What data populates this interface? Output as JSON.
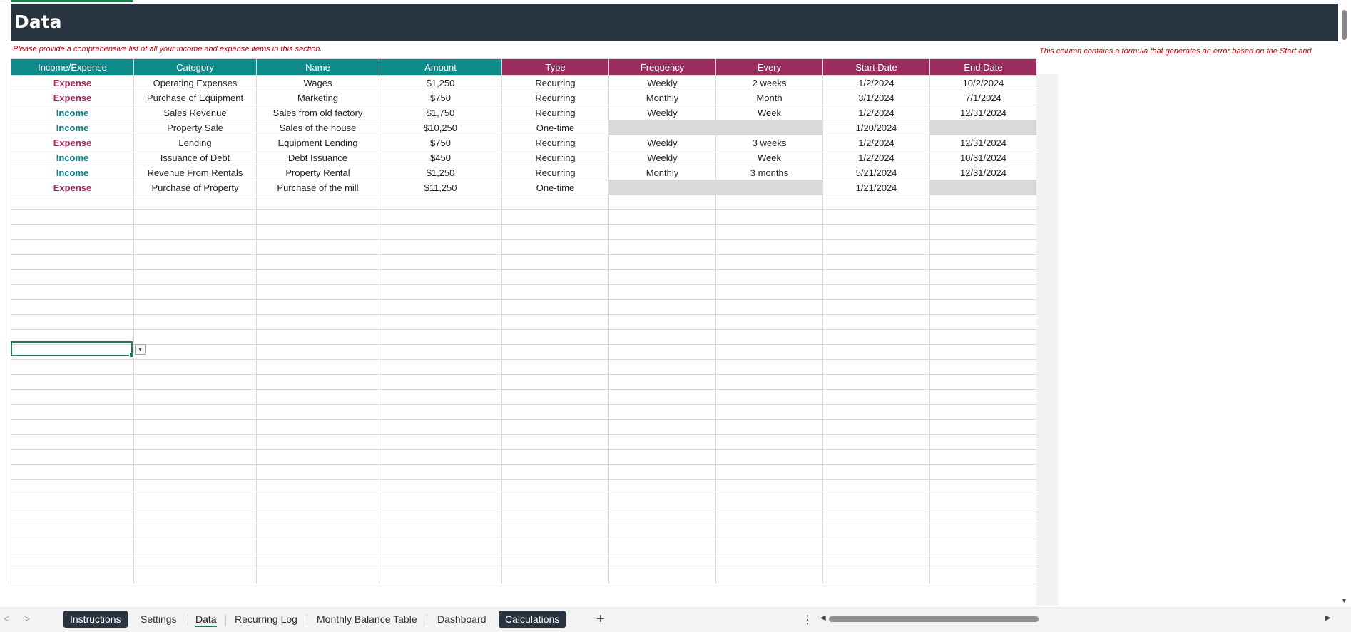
{
  "sheet": {
    "title": "Data",
    "note_left": "Please provide a comprehensive list of all your income and expense items in this section.",
    "note_right": "This column contains a formula that generates an error based on the Start and"
  },
  "table": {
    "headers": [
      "Income/Expense",
      "Category",
      "Name",
      "Amount",
      "Type",
      "Frequency",
      "Every",
      "Start Date",
      "End Date"
    ],
    "header_colors": {
      "teal": "#0f8a8a",
      "plum": "#9b2d5e"
    },
    "rows": [
      [
        "Expense",
        "Operating Expenses",
        "Wages",
        "$1,250",
        "Recurring",
        "Weekly",
        "2 weeks",
        "1/2/2024",
        "10/2/2024"
      ],
      [
        "Expense",
        "Purchase of Equipment",
        "Marketing",
        "$750",
        "Recurring",
        "Monthly",
        "Month",
        "3/1/2024",
        "7/1/2024"
      ],
      [
        "Income",
        "Sales Revenue",
        "Sales from old factory",
        "$1,750",
        "Recurring",
        "Weekly",
        "Week",
        "1/2/2024",
        "12/31/2024"
      ],
      [
        "Income",
        "Property Sale",
        "Sales of the house",
        "$10,250",
        "One-time",
        "",
        "",
        "1/20/2024",
        ""
      ],
      [
        "Expense",
        "Lending",
        "Equipment Lending",
        "$750",
        "Recurring",
        "Weekly",
        "3 weeks",
        "1/2/2024",
        "12/31/2024"
      ],
      [
        "Income",
        "Issuance of Debt",
        "Debt Issuance",
        "$450",
        "Recurring",
        "Weekly",
        "Week",
        "1/2/2024",
        "10/31/2024"
      ],
      [
        "Income",
        "Revenue From Rentals",
        "Property Rental",
        "$1,250",
        "Recurring",
        "Monthly",
        "3 months",
        "5/21/2024",
        "12/31/2024"
      ],
      [
        "Expense",
        "Purchase of Property",
        "Purchase of the mill",
        "$11,250",
        "One-time",
        "",
        "",
        "1/21/2024",
        ""
      ]
    ],
    "empty_row_count": 26
  },
  "tabs": [
    {
      "label": "Instructions",
      "style": "dark"
    },
    {
      "label": "Settings",
      "style": "plain"
    },
    {
      "label": "Data",
      "style": "active"
    },
    {
      "label": "Recurring Log",
      "style": "plain"
    },
    {
      "label": "Monthly Balance Table",
      "style": "plain"
    },
    {
      "label": "Dashboard",
      "style": "plain"
    },
    {
      "label": "Calculations",
      "style": "dark"
    }
  ],
  "controls": {
    "add_sheet": "+",
    "menu": "⋮",
    "nav_prev": "<",
    "nav_next": ">",
    "scroll_left": "◀",
    "scroll_right": "▶",
    "scroll_down": "▼",
    "dropdown_arrow": "▾"
  },
  "colors": {
    "banner": "#283540",
    "expense": "#a5285b",
    "income": "#0c7f8a",
    "note": "#c00000",
    "accent": "#1f7a4d"
  }
}
